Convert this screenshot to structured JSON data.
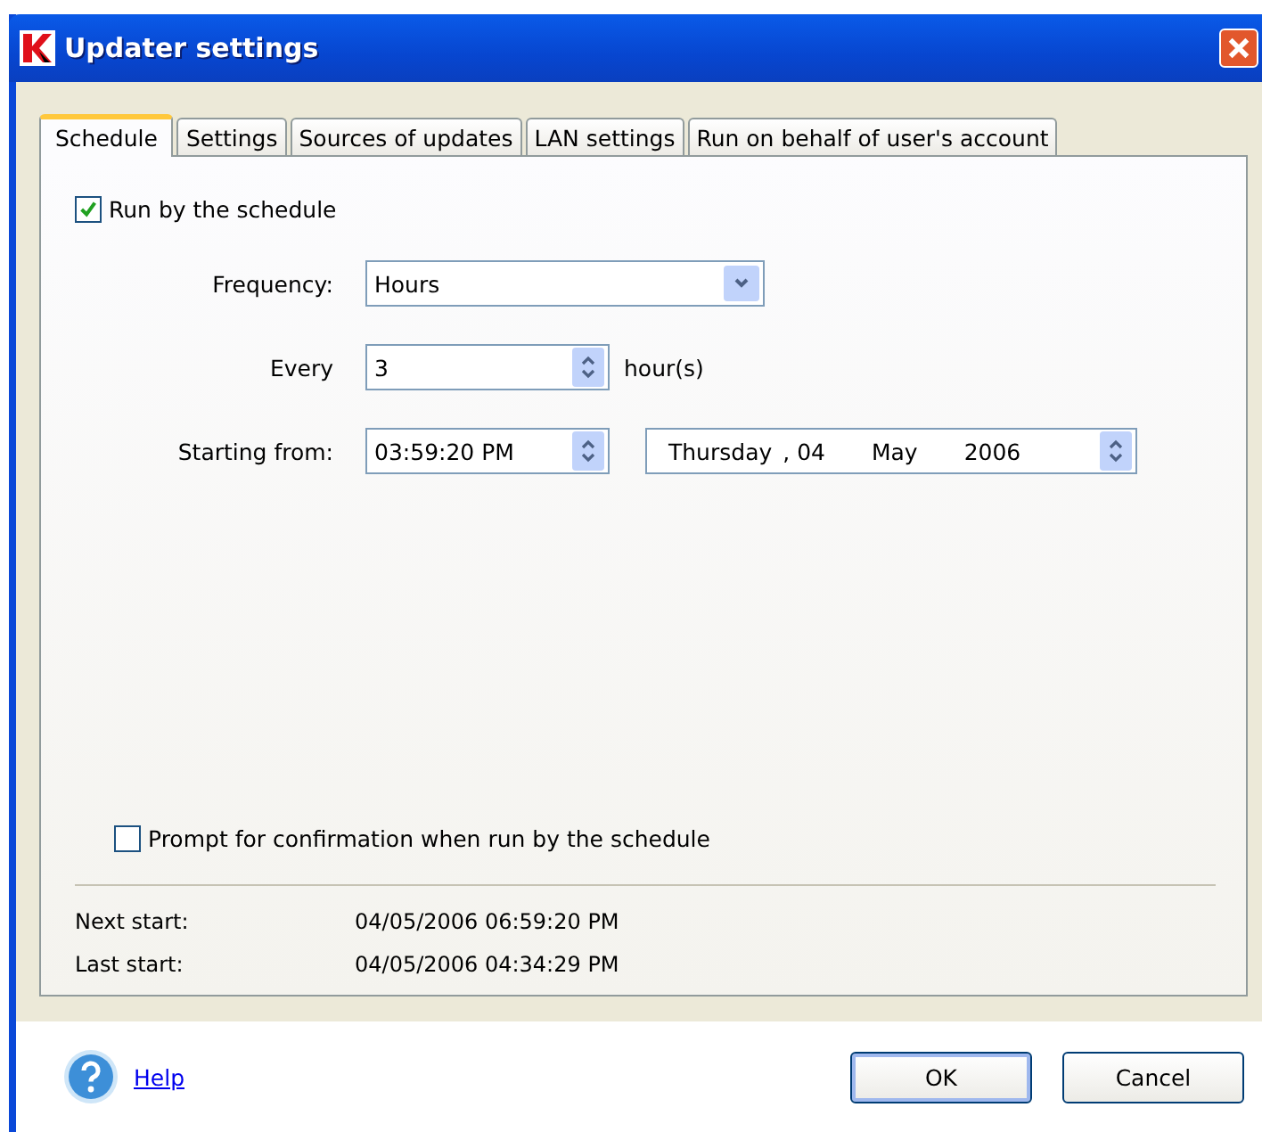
{
  "window": {
    "title": "Updater settings"
  },
  "tabs": [
    {
      "label": "Schedule",
      "selected": true
    },
    {
      "label": "Settings",
      "selected": false
    },
    {
      "label": "Sources of updates",
      "selected": false
    },
    {
      "label": "LAN settings",
      "selected": false
    },
    {
      "label": "Run on behalf of user's account",
      "selected": false
    }
  ],
  "run_by_schedule": {
    "label": "Run by the schedule",
    "checked": true
  },
  "frequency": {
    "label": "Frequency:",
    "value": "Hours"
  },
  "every": {
    "label": "Every",
    "value": "3",
    "unit": "hour(s)"
  },
  "starting_from": {
    "label": "Starting from:",
    "time": "03:59:20 PM",
    "date_parts": [
      "Thursday",
      ", 04",
      "May",
      "2006"
    ]
  },
  "prompt_confirmation": {
    "label": "Prompt for confirmation when run by the schedule",
    "checked": false
  },
  "info": [
    {
      "label": "Next start:",
      "value": "04/05/2006 06:59:20 PM"
    },
    {
      "label": "Last start:",
      "value": "04/05/2006 04:34:29 PM"
    }
  ],
  "footer": {
    "help": "Help",
    "buttons": [
      "OK",
      "Cancel"
    ]
  }
}
